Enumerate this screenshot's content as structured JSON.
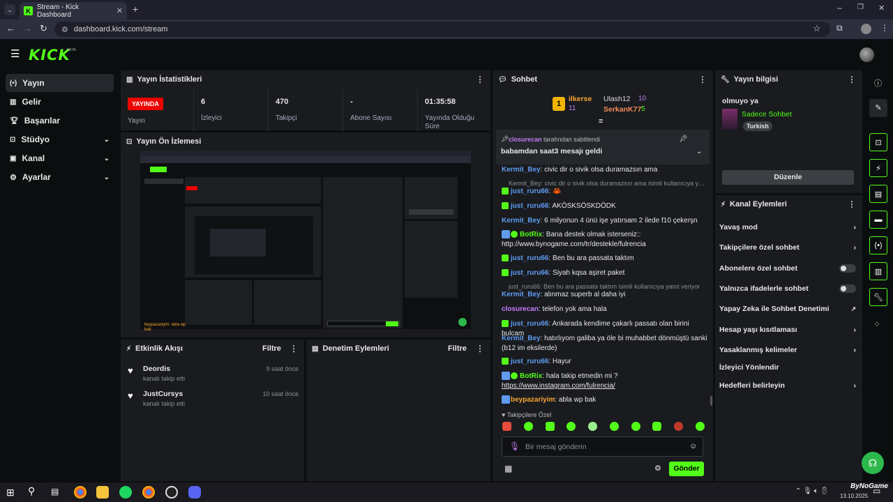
{
  "browser": {
    "tab_title": "Stream - Kick Dashboard",
    "url": "dashboard.kick.com/stream"
  },
  "app": {
    "logo": "KICK",
    "logo_badge": "BETA"
  },
  "sidebar": {
    "items": [
      {
        "label": "Yayın",
        "icon": "broadcast-icon"
      },
      {
        "label": "Gelir",
        "icon": "revenue-icon"
      },
      {
        "label": "Başarılar",
        "icon": "trophy-icon"
      },
      {
        "label": "Stüdyo",
        "icon": "studio-icon"
      },
      {
        "label": "Kanal",
        "icon": "channel-icon"
      },
      {
        "label": "Ayarlar",
        "icon": "gear-icon"
      }
    ]
  },
  "stats": {
    "title": "Yayın İstatistikleri",
    "live_badge": "YAYINDA",
    "live_label": "Yayın",
    "cells": [
      {
        "value": "6",
        "label": "İzleyici"
      },
      {
        "value": "470",
        "label": "Takipçi"
      },
      {
        "value": "-",
        "label": "Abone Sayısı"
      },
      {
        "value": "01:35:58",
        "label": "Yayında Olduğu Süre"
      }
    ]
  },
  "preview": {
    "title": "Yayın Ön İzlemesi"
  },
  "activity": {
    "title": "Etkinlik Akışı",
    "filter": "Filtre",
    "items": [
      {
        "name": "Deordis",
        "desc": "kanalı takip etti",
        "time": "9 saat önce"
      },
      {
        "name": "JustCursys",
        "desc": "kanalı takip etti",
        "time": "10 saat önce"
      }
    ]
  },
  "moderation": {
    "title": "Denetim Eylemleri",
    "filter": "Filtre"
  },
  "chat": {
    "title": "Sohbet",
    "leaders": [
      {
        "name": "ilkerse",
        "score": "11"
      },
      {
        "name": "Ulash12",
        "score": "10"
      },
      {
        "name": "SerkanK77",
        "score": "5"
      }
    ],
    "leader_rank": "1",
    "pinned_by": "closurecan",
    "pinned_suffix": "tarafından sabitlendi",
    "pinned_message": "babamdan saat3 mesajı geldi",
    "messages": [
      {
        "user": "Kermit_Bey",
        "text": ": civic dir o sivik olsa duramazsın ama"
      },
      {
        "reply": "Kermit_Bey: civic dir o sivik olsa duramazsın ama isimli kullanıcıya yan..."
      },
      {
        "user": "just_ruru66",
        "text": ": 🦀"
      },
      {
        "user": "just_ruru66",
        "text": ": AKÖSKSÖSKDÖDK"
      },
      {
        "user": "Kermit_Bey",
        "text": ": 6 milyonun 4 ünü işe yatırsam 2 ilede f10 çekerşn"
      },
      {
        "user": "BotRix",
        "text": ": Bana destek olmak isterseniz:: http://www.bynogame.com/tr/destekle/fulrencia"
      },
      {
        "user": "just_ruru66",
        "text": ": Ben bu ara passata taktım"
      },
      {
        "user": "just_ruru66",
        "text": ": Siyah kqsa aşiret paket"
      },
      {
        "reply": "just_ruru66: Ben bu ara passata taktım isimli kullanıcıya yanıt veriyor"
      },
      {
        "user": "Kermit_Bey",
        "text": ": alınmaz superb al daha iyi"
      },
      {
        "user": "closurecan",
        "text": ": telefon yok ama hala"
      },
      {
        "user": "just_ruru66",
        "text": ": Ankarada kendime çakarlı passatı olan birini bulcam"
      },
      {
        "user": "Kermit_Bey",
        "text": ": hatırlıyom galiba ya öle bi muhabbet dönmüştü sanki (b12 im eksilerde)"
      },
      {
        "user": "just_ruru66",
        "text": ": Hayur"
      },
      {
        "user": "BotRix",
        "text": ": hala takip etmedin mi ?",
        "link": "https://www.instagram.com/fulrencia/"
      },
      {
        "user": "beypazariyim",
        "text": ": abla wp bak"
      }
    ],
    "followers_only": "Takipçilere Özel",
    "input_placeholder": "Bir mesaj gönderin",
    "send": "Gönder"
  },
  "stream_info": {
    "title": "Yayın bilgisi",
    "stream_title": "olmuyo ya",
    "category": "Sadece Sohbet",
    "tag": "Turkish",
    "edit": "Düzenle"
  },
  "channel_actions": {
    "title": "Kanal Eylemleri",
    "items": [
      {
        "label": "Yavaş mod",
        "control": "chevron"
      },
      {
        "label": "Takipçilere özel sohbet",
        "control": "chevron"
      },
      {
        "label": "Abonelere özel sohbet",
        "control": "toggle"
      },
      {
        "label": "Yalnızca ifadelerle sohbet",
        "control": "toggle"
      },
      {
        "label": "Yapay Zeka ile Sohbet Denetimi",
        "control": "external"
      },
      {
        "label": "Hesap yaşı kısıtlaması",
        "control": "chevron"
      },
      {
        "label": "Yasaklanmış kelimeler",
        "control": "chevron"
      },
      {
        "label": "İzleyici Yönlendir",
        "control": "none"
      },
      {
        "label": "Hedefleri belirleyin",
        "control": "chevron"
      }
    ]
  },
  "taskbar": {
    "date": "13.10.2025",
    "watermark": "ByNoGame"
  },
  "colors": {
    "accent": "#53fc18",
    "live": "#eb0400",
    "panel": "#191b1f",
    "background": "#0b0e0f",
    "username_blue": "#5f9cf0"
  }
}
